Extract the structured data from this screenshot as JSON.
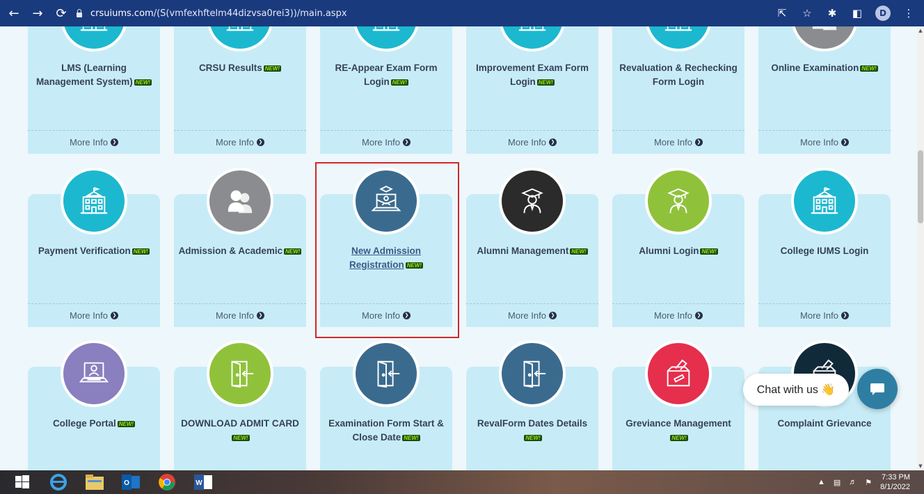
{
  "browser": {
    "url_host": "crsuiums.com",
    "url_path": "/(S(vmfexhftelm44dizvsa0rei3))/main.aspx",
    "profile_initial": "D"
  },
  "badge_text": "NEW!",
  "more_info_label": "More Info",
  "cards": [
    {
      "title": "LMS (Learning Management System)",
      "new": true,
      "color": "#1cb8cf",
      "icon": "building-icon"
    },
    {
      "title": "CRSU Results",
      "new": true,
      "color": "#1cb8cf",
      "icon": "building-icon"
    },
    {
      "title": "RE-Appear Exam Form Login",
      "new": true,
      "color": "#1cb8cf",
      "icon": "building-icon"
    },
    {
      "title": "Improvement Exam Form Login",
      "new": true,
      "color": "#1cb8cf",
      "icon": "building-icon"
    },
    {
      "title": "Revaluation & Rechecking Form Login",
      "new": false,
      "color": "#1cb8cf",
      "icon": "building-icon"
    },
    {
      "title": "Online Examination",
      "new": true,
      "color": "#8a8c8f",
      "icon": "people-icon"
    },
    {
      "title": "Payment Verification",
      "new": true,
      "color": "#1cb8cf",
      "icon": "building-icon"
    },
    {
      "title": "Admission & Academic",
      "new": true,
      "color": "#8a8c8f",
      "icon": "people-icon"
    },
    {
      "title": "New Admission Registration",
      "new": true,
      "color": "#3a6b8e",
      "icon": "laptop-student-icon",
      "highlighted": true
    },
    {
      "title": "Alumni Management",
      "new": true,
      "color": "#2b2b2b",
      "icon": "graduate-icon"
    },
    {
      "title": "Alumni Login",
      "new": true,
      "color": "#8fc23a",
      "icon": "graduate-icon"
    },
    {
      "title": "College IUMS Login",
      "new": false,
      "color": "#1cb8cf",
      "icon": "building-icon"
    },
    {
      "title": "College Portal",
      "new": true,
      "color": "#8a7fbf",
      "icon": "laptop-user-icon"
    },
    {
      "title": "DOWNLOAD ADMIT CARD",
      "new": true,
      "color": "#8fc23a",
      "icon": "door-enter-icon"
    },
    {
      "title": "Examination Form Start & Close Date",
      "new": true,
      "color": "#3a6b8e",
      "icon": "door-enter-icon"
    },
    {
      "title": "RevalForm Dates Details",
      "new": true,
      "color": "#3a6b8e",
      "icon": "door-enter-icon"
    },
    {
      "title": "Greviance Management",
      "new": true,
      "color": "#e62e4d",
      "icon": "ballot-box-icon"
    },
    {
      "title": "Complaint Grievance",
      "new": false,
      "color": "#112a3a",
      "icon": "ballot-box-icon"
    }
  ],
  "chat": {
    "label": "Chat with us 👋"
  },
  "taskbar": {
    "time": "7:33 PM",
    "date": "8/1/2022"
  }
}
